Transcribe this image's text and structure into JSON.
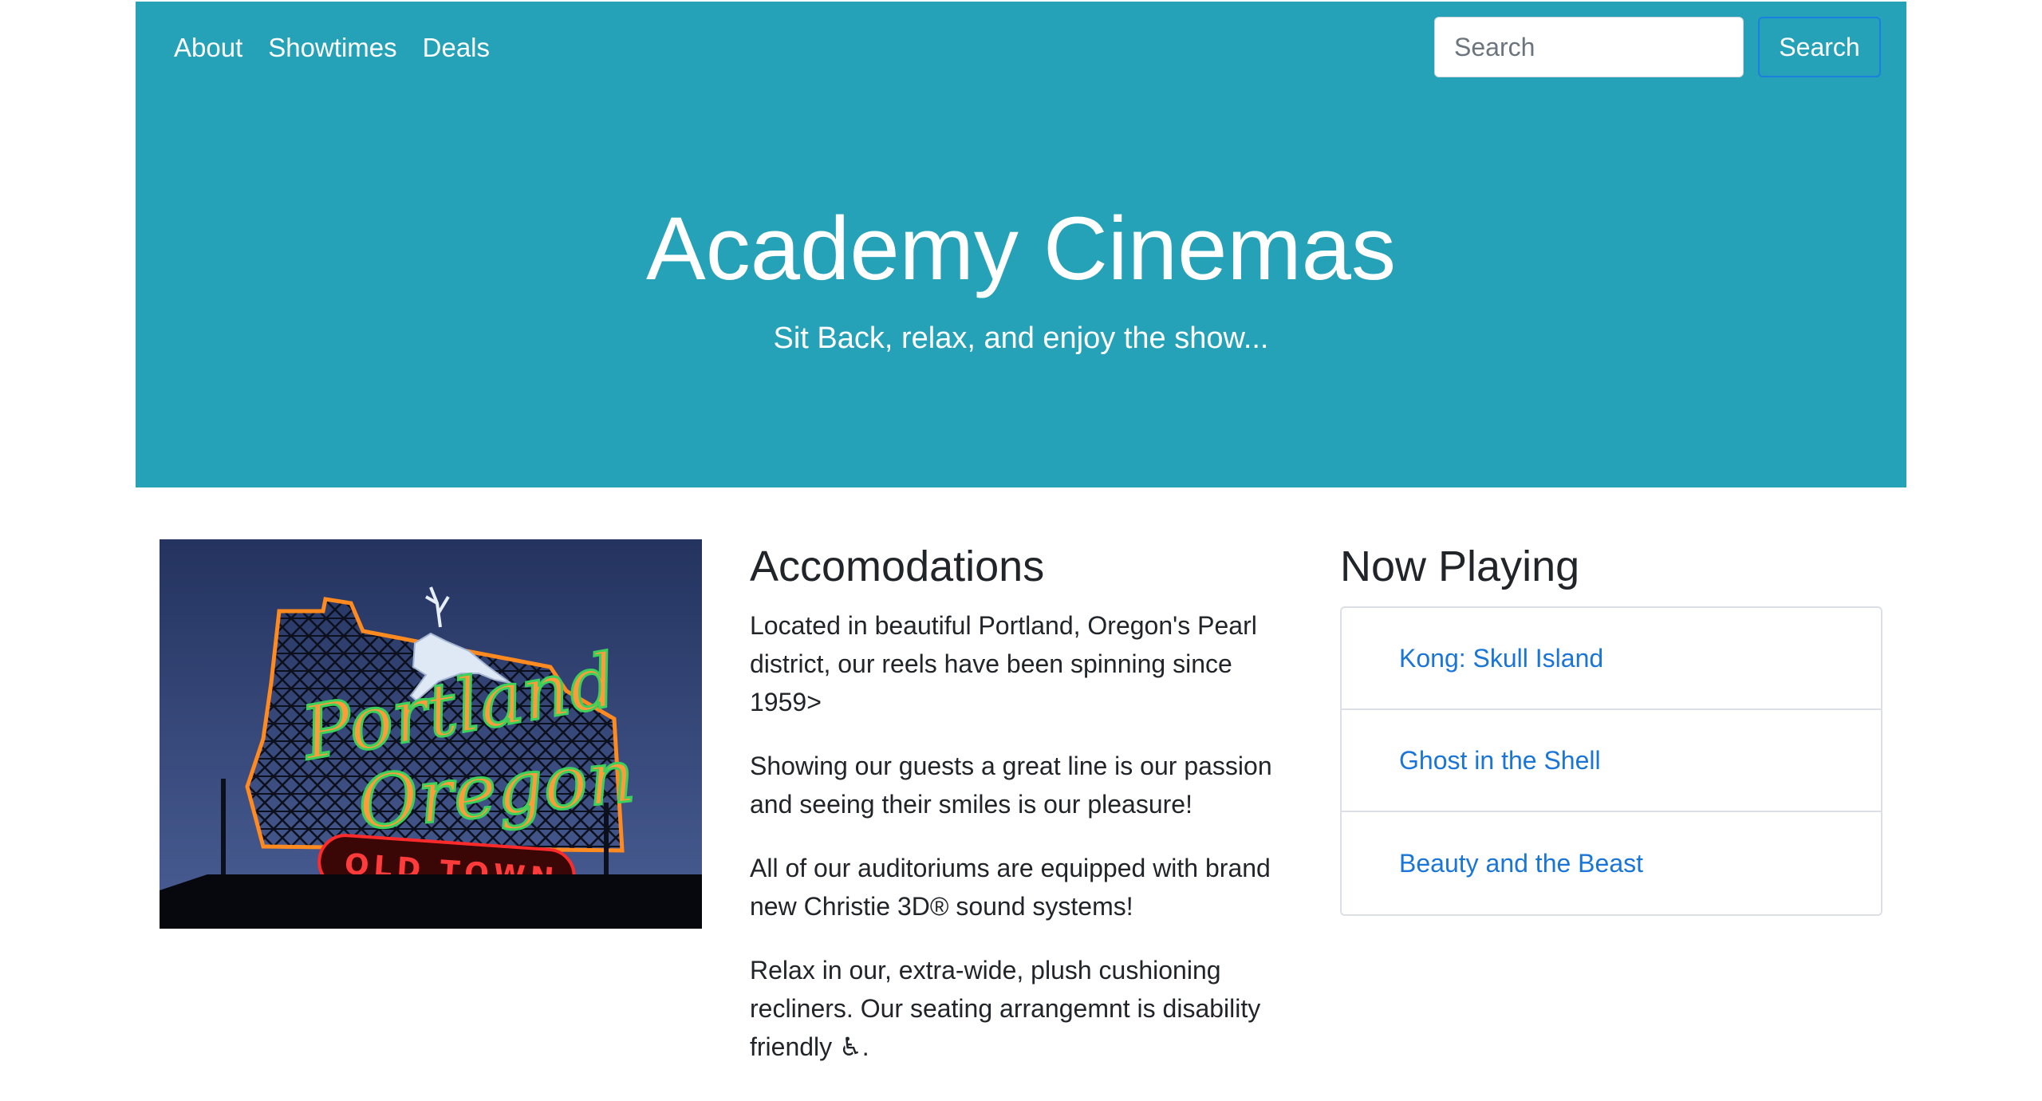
{
  "nav": {
    "links": [
      "About",
      "Showtimes",
      "Deals"
    ]
  },
  "search": {
    "placeholder": "Search",
    "button_label": "Search"
  },
  "hero": {
    "title": "Academy Cinemas",
    "tagline": "Sit Back, relax, and enjoy the show..."
  },
  "photo": {
    "sign_line1": "Portland",
    "sign_line2": "Oregon",
    "sign_line3": "OLD TOWN"
  },
  "accommodations": {
    "heading": "Accomodations",
    "paragraphs": [
      "Located in beautiful Portland, Oregon's Pearl district, our reels have been spinning since 1959>",
      "Showing our guests a great line is our passion and seeing their smiles is our pleasure!",
      "All of our auditoriums are equipped with brand new Christie 3D® sound systems!",
      "Relax in our, extra-wide, plush cushioning recliners. Our seating arrangemnt is disability friendly ♿."
    ]
  },
  "now_playing": {
    "heading": "Now Playing",
    "movies": [
      "Kong: Skull Island",
      "Ghost in the Shell",
      "Beauty and the Beast"
    ]
  },
  "colors": {
    "header_bg": "#25a2b8",
    "link_blue": "#1a75d8"
  }
}
